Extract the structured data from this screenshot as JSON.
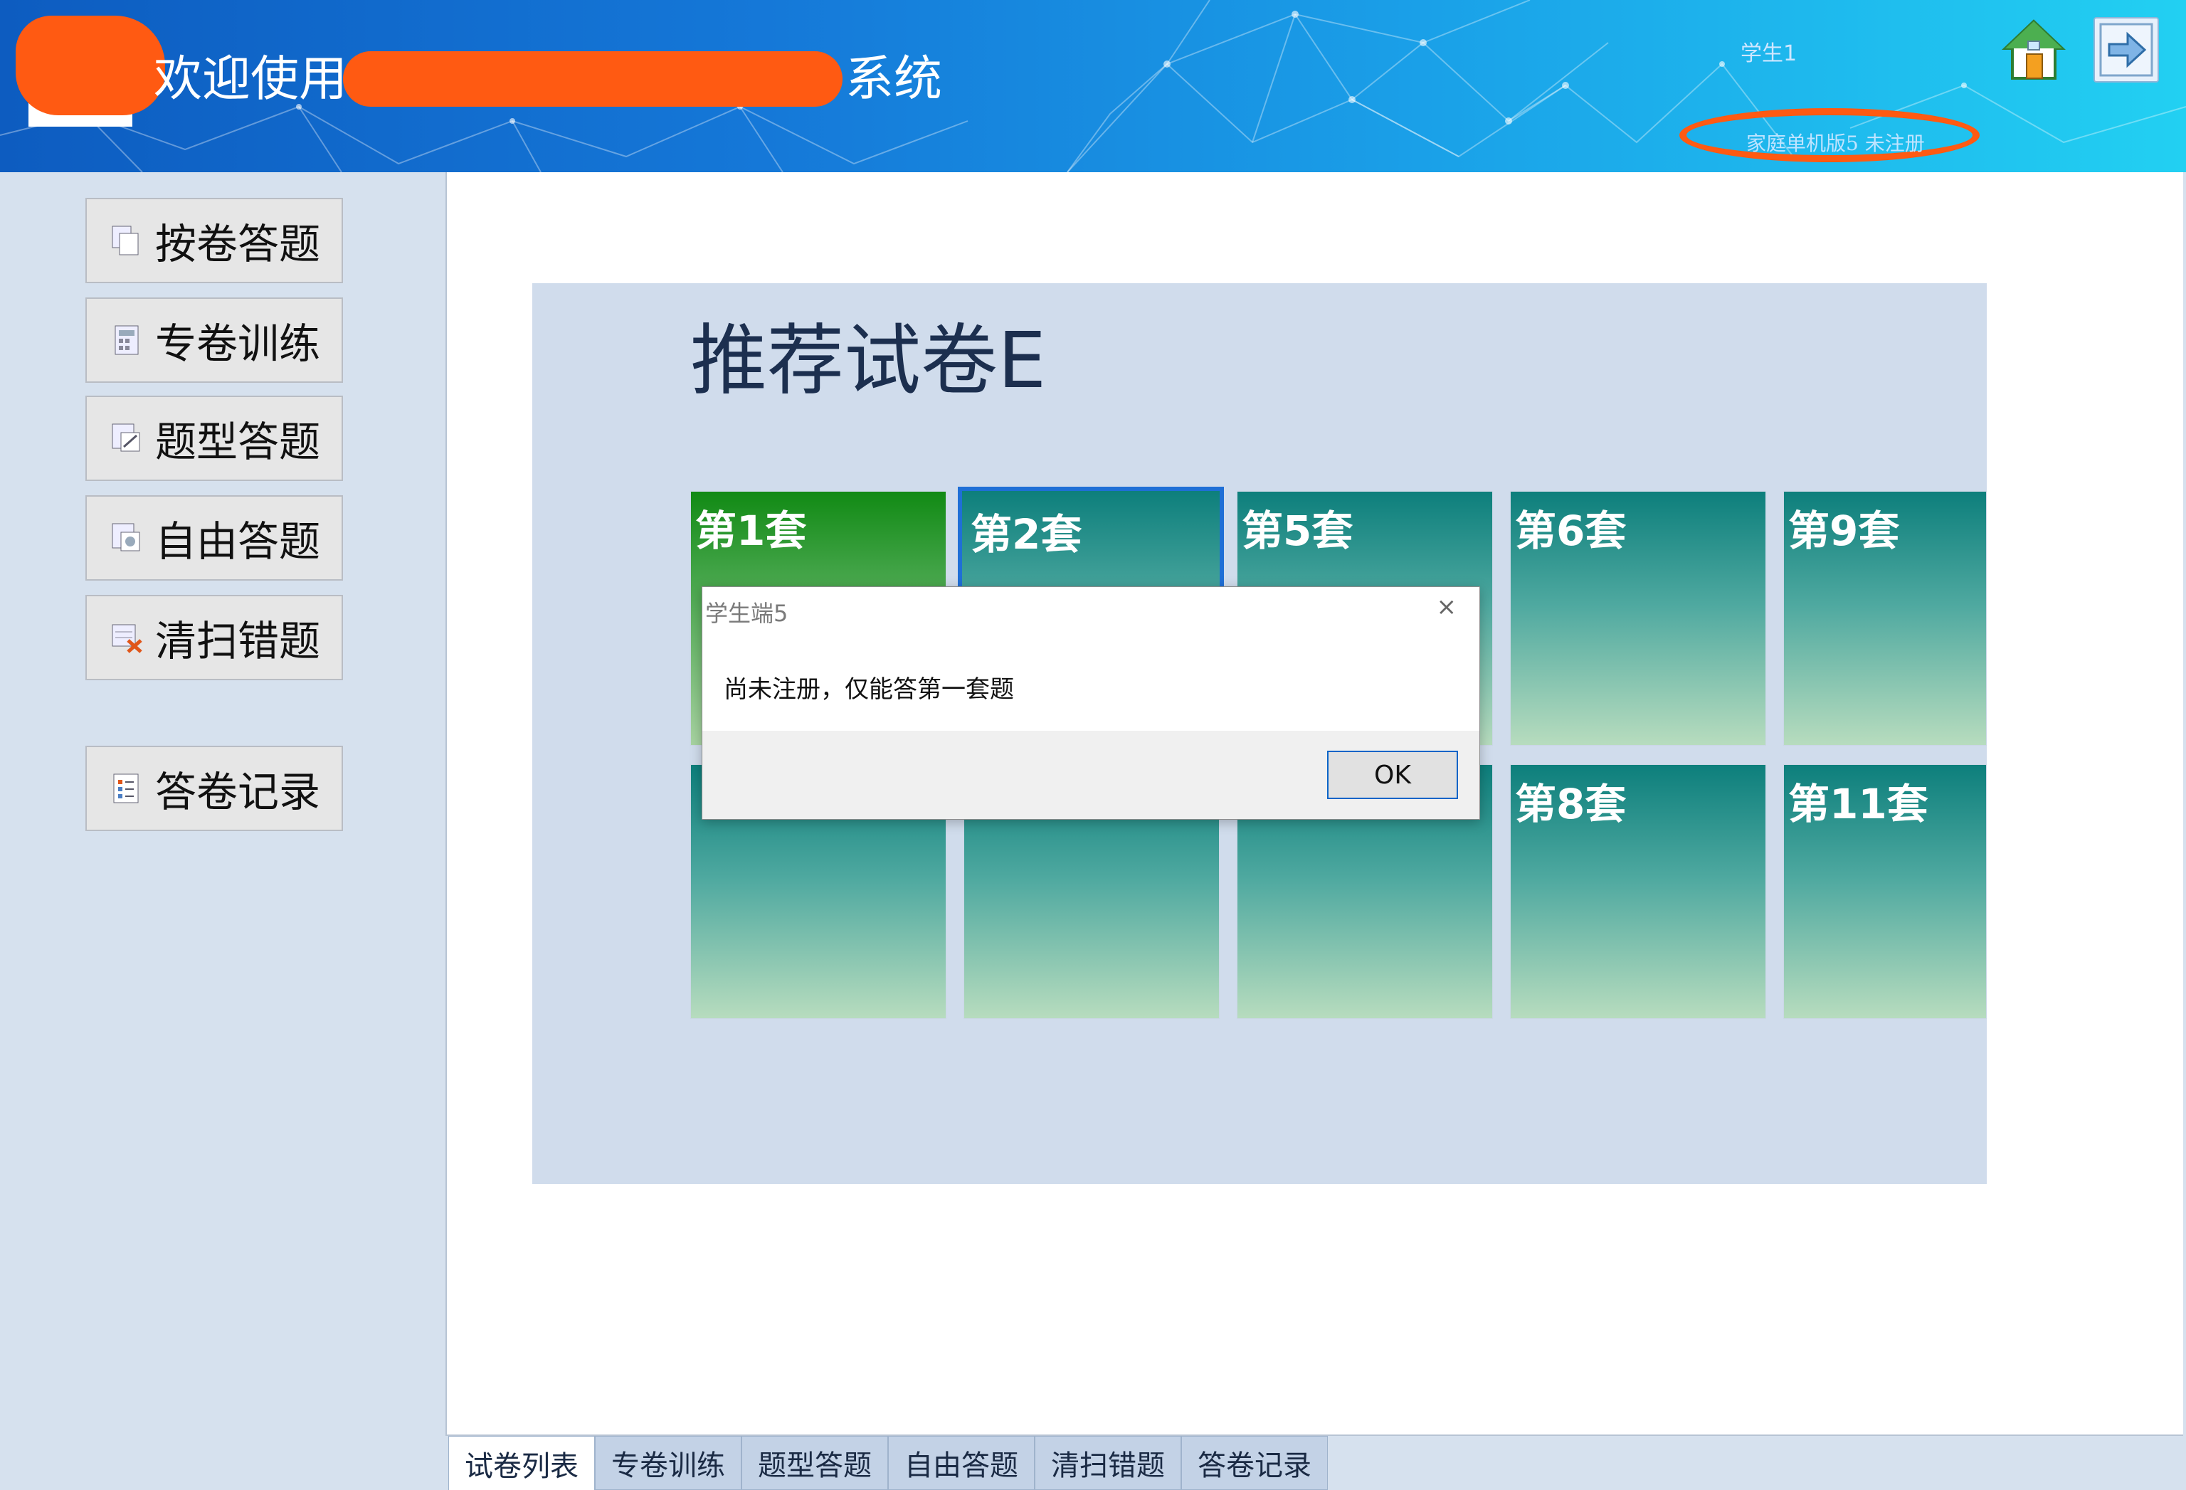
{
  "header": {
    "welcome_prefix": "欢迎使用",
    "welcome_suffix": "系统",
    "user_name": "学生1",
    "edition_status": "家庭单机版5   未注册",
    "home_icon": "home-icon",
    "exit_icon": "exit-arrow-icon"
  },
  "nav": {
    "items": [
      {
        "label": "按卷答题",
        "icon": "papers-icon"
      },
      {
        "label": "专卷训练",
        "icon": "calculator-icon"
      },
      {
        "label": "题型答题",
        "icon": "question-type-icon"
      },
      {
        "label": "自由答题",
        "icon": "free-answer-icon"
      },
      {
        "label": "清扫错题",
        "icon": "clear-errors-icon"
      },
      {
        "label": "答卷记录",
        "icon": "record-icon"
      }
    ]
  },
  "main": {
    "title": "推荐试卷E",
    "tiles": [
      "第1套",
      "第2套",
      "第5套",
      "第6套",
      "第9套",
      "",
      "",
      "",
      "第8套",
      "第11套"
    ]
  },
  "dialog": {
    "title": "学生端5",
    "message": "尚未注册，仅能答第一套题",
    "ok_label": "OK",
    "close_glyph": "×"
  },
  "tabs": [
    "试卷列表",
    "专卷训练",
    "题型答题",
    "自由答题",
    "清扫错题",
    "答卷记录"
  ],
  "colors": {
    "header_left": "#0d5cc0",
    "header_right": "#22d0f2",
    "tile_teal": "#0d7f7c",
    "tile_green": "#118a14",
    "redaction": "#ff5a12"
  }
}
